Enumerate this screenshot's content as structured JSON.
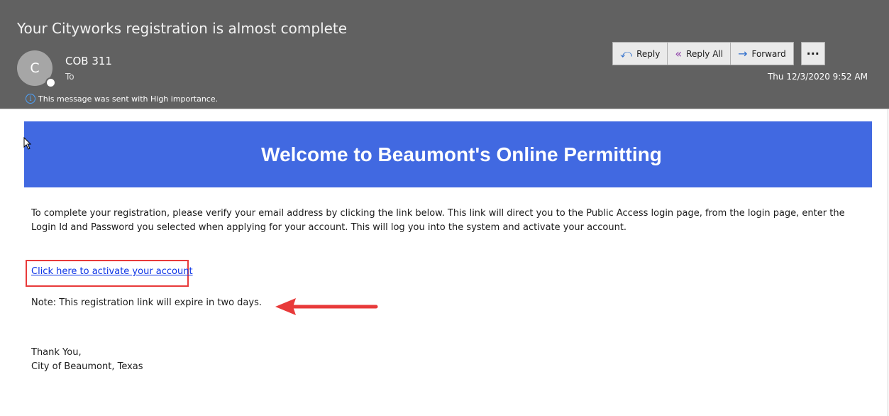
{
  "email": {
    "subject": "Your Cityworks registration is almost complete",
    "sender_initial": "C",
    "sender_name": "COB 311",
    "to_label": "To",
    "importance_notice": "This message was sent with High importance.",
    "date": "Thu 12/3/2020 9:52 AM"
  },
  "actions": {
    "reply": "Reply",
    "reply_all": "Reply All",
    "forward": "Forward",
    "more": "···"
  },
  "body": {
    "banner_title": "Welcome to Beaumont's Online Permitting",
    "instructions": "To complete your registration, please verify your email address by clicking the link below. This link will direct you to the Public Access login page, from the login page, enter the Login Id and Password you selected when applying for your account. This will log you into the system and activate your account.",
    "activate_link": "Click here to activate your account",
    "note": "Note: This registration link will expire in two days.",
    "signoff_line1": "Thank You,",
    "signoff_line2": "City of Beaumont, Texas"
  },
  "colors": {
    "header_bg": "#616161",
    "banner_bg": "#4169e1",
    "link": "#0b33e6",
    "annotation_red": "#e83a3a"
  },
  "icons": {
    "reply": "reply-arrow-icon",
    "reply_all": "reply-all-arrow-icon",
    "forward": "forward-arrow-icon",
    "info": "info-circle-icon",
    "annotation": "red-arrow-icon"
  }
}
